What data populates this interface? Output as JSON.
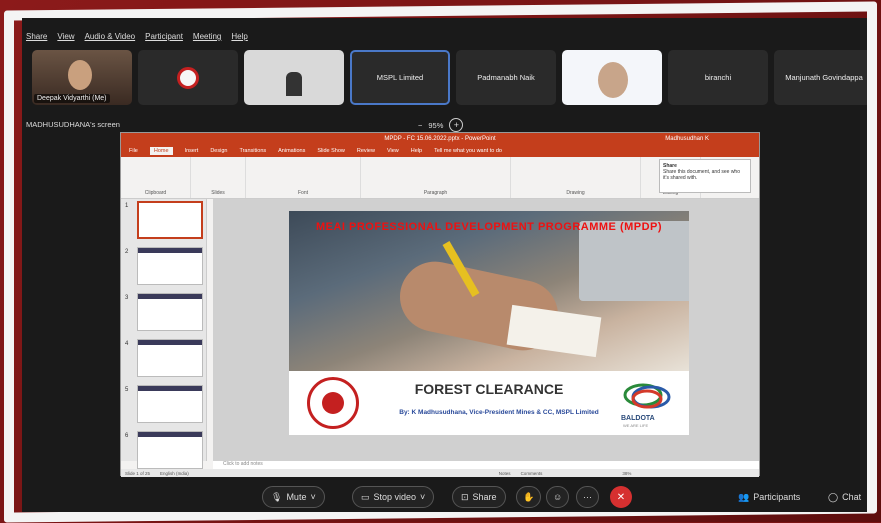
{
  "menubar": {
    "items": [
      "Share",
      "View",
      "Audio & Video",
      "Participant",
      "Meeting",
      "Help"
    ]
  },
  "gallery": [
    {
      "name": "Deepak Vidyarthi (Me)",
      "kind": "cam"
    },
    {
      "name": "",
      "kind": "logo"
    },
    {
      "name": "",
      "kind": "room"
    },
    {
      "name": "MSPL Limited",
      "kind": "text",
      "active": true
    },
    {
      "name": "Padmanabh Naik",
      "kind": "text"
    },
    {
      "name": "",
      "kind": "slide"
    },
    {
      "name": "biranchi",
      "kind": "text"
    },
    {
      "name": "Manjunath Govindappa",
      "kind": "text"
    }
  ],
  "screenbar": {
    "who": "MADHUSUDHANA's screen",
    "zoom": "95%",
    "minus": "−",
    "plus": "+"
  },
  "ppt": {
    "title": "MPDP - FC 15.06.2022.pptx - PowerPoint",
    "user": "Madhusudhan K",
    "tabs": [
      "File",
      "Home",
      "Insert",
      "Design",
      "Transitions",
      "Animations",
      "Slide Show",
      "Review",
      "View",
      "Help",
      "Tell me what you want to do"
    ],
    "ribbon_groups": [
      "Clipboard",
      "Slides",
      "Font",
      "Paragraph",
      "Drawing",
      "Editing"
    ],
    "share_title": "Share",
    "share_desc": "Share this document, and see who it's shared with.",
    "slide_numbers": [
      "1",
      "2",
      "3",
      "4",
      "5",
      "6"
    ],
    "banner": "MEAI PROFESSIONAL DEVELOPMENT PROGRAMME (MPDP)",
    "slide_title": "FOREST CLEARANCE",
    "slide_sub": "By: K Madhusudhana, Vice-President Mines & CC, MSPL Limited",
    "logo_text": "BALDOTA",
    "logo_tag": "WE ARE LIFE",
    "notes": "Click to add notes",
    "status_slide": "Slide 1 of 25",
    "status_lang": "English (India)",
    "status_notes": "Notes",
    "status_comments": "Comments",
    "status_zoom": "38%"
  },
  "controls": {
    "mute": "Mute",
    "video": "Stop video",
    "share": "Share",
    "participants": "Participants",
    "chat": "Chat"
  }
}
